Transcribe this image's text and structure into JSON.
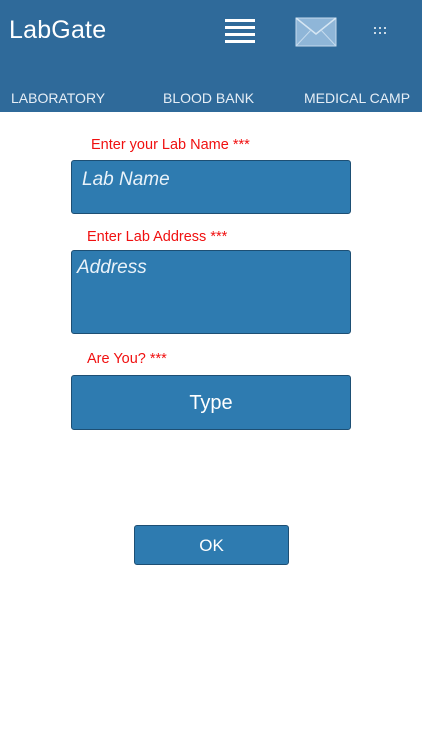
{
  "appbar": {
    "title": "LabGate",
    "icons": [
      "menu-icon",
      "mail-icon",
      "more-icon"
    ]
  },
  "tabs": [
    {
      "label": "LABORATORY"
    },
    {
      "label": "BLOOD BANK"
    },
    {
      "label": "MEDICAL CAMP"
    }
  ],
  "form": {
    "lab_name": {
      "label": "Enter your Lab Name ***",
      "placeholder": "Lab Name",
      "value": ""
    },
    "lab_address": {
      "label": "Enter Lab Address  ***",
      "placeholder": "Address",
      "value": ""
    },
    "type": {
      "label": "Are You? ***",
      "selected": "Type"
    },
    "ok_label": "OK"
  },
  "colors": {
    "appbar": "#2f6a9a",
    "field": "#2e7bb0",
    "label": "#f01010"
  }
}
